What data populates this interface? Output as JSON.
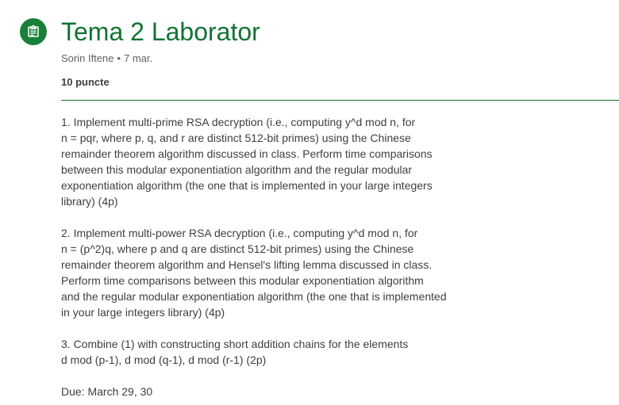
{
  "assignment": {
    "icon": "assignment-icon",
    "accent_color": "#137333",
    "title": "Tema 2 Laborator",
    "author": "Sorin Iftene",
    "separator": "•",
    "date": "7 mar.",
    "points": "10 puncte"
  },
  "description": {
    "paragraph1": [
      "1. Implement multi-prime RSA decryption (i.e., computing y^d mod n, for",
      "n = pqr, where p, q, and r are distinct 512-bit primes) using the Chinese",
      "remainder theorem algorithm discussed in class. Perform time comparisons",
      "between this modular exponentiation algorithm and the regular modular",
      "exponentiation algorithm (the one that is implemented in your large integers",
      "library) (4p)"
    ],
    "paragraph2": [
      "2. Implement multi-power RSA decryption (i.e., computing y^d mod n, for",
      "n = (p^2)q, where p and q are distinct 512-bit primes) using the Chinese",
      "remainder theorem algorithm and Hensel's lifting lemma discussed in class.",
      "Perform time comparisons between this modular exponentiation algorithm",
      "and the regular modular exponentiation algorithm (the one that is implemented",
      "in your large integers library) (4p)"
    ],
    "paragraph3": [
      "3. Combine (1) with constructing short addition chains for the elements",
      "d mod (p-1), d mod (q-1), d mod (r-1) (2p)"
    ],
    "due": "Due: March 29, 30"
  }
}
